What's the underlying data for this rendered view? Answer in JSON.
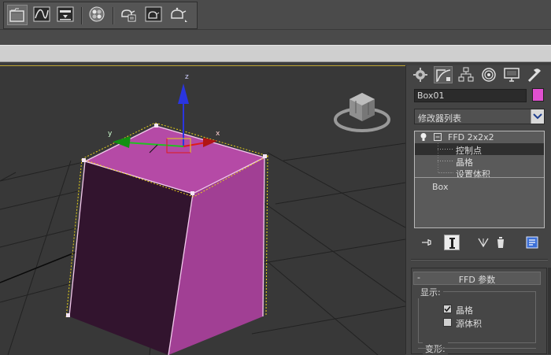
{
  "panel": {
    "object_name": "Box01",
    "object_color": "#e050d0",
    "modifier_list": "修改器列表",
    "stack": [
      {
        "label": "FFD 2x2x2",
        "level": 0,
        "selected": false
      },
      {
        "label": "控制点",
        "level": 1,
        "selected": true
      },
      {
        "label": "晶格",
        "level": 1,
        "selected": false
      },
      {
        "label": "设置体积",
        "level": 1,
        "selected": false
      },
      {
        "label": "Box",
        "level": 0,
        "selected": false
      }
    ],
    "rollout": {
      "title": "FFD 参数",
      "collapse": "-",
      "display_group": "显示:",
      "checkbox_lattice": "晶格",
      "checkbox_source_volume": "源体积",
      "deform_group": "变形:"
    }
  },
  "gizmo": {
    "axis_x": "x",
    "axis_y": "y",
    "axis_z": "z"
  },
  "colors": {
    "box_top": "#b54aa6",
    "box_front": "#32142e",
    "box_side": "#a13f94",
    "gizmo_x": "#e01a1a",
    "gizmo_y": "#22c022",
    "gizmo_z": "#2a35e0"
  },
  "icons": [
    "select-object-icon",
    "curve-editor-icon",
    "schematic-view-icon",
    "material-editor-icon",
    "render-setup-icon",
    "render-frame-icon",
    "quick-render-icon",
    "create-tab-icon",
    "modify-tab-icon",
    "hierarchy-tab-icon",
    "motion-tab-icon",
    "display-tab-icon",
    "utilities-tab-icon",
    "pin-stack-icon",
    "show-end-result-icon",
    "make-unique-icon",
    "remove-modifier-icon",
    "configure-modifier-sets-icon"
  ]
}
